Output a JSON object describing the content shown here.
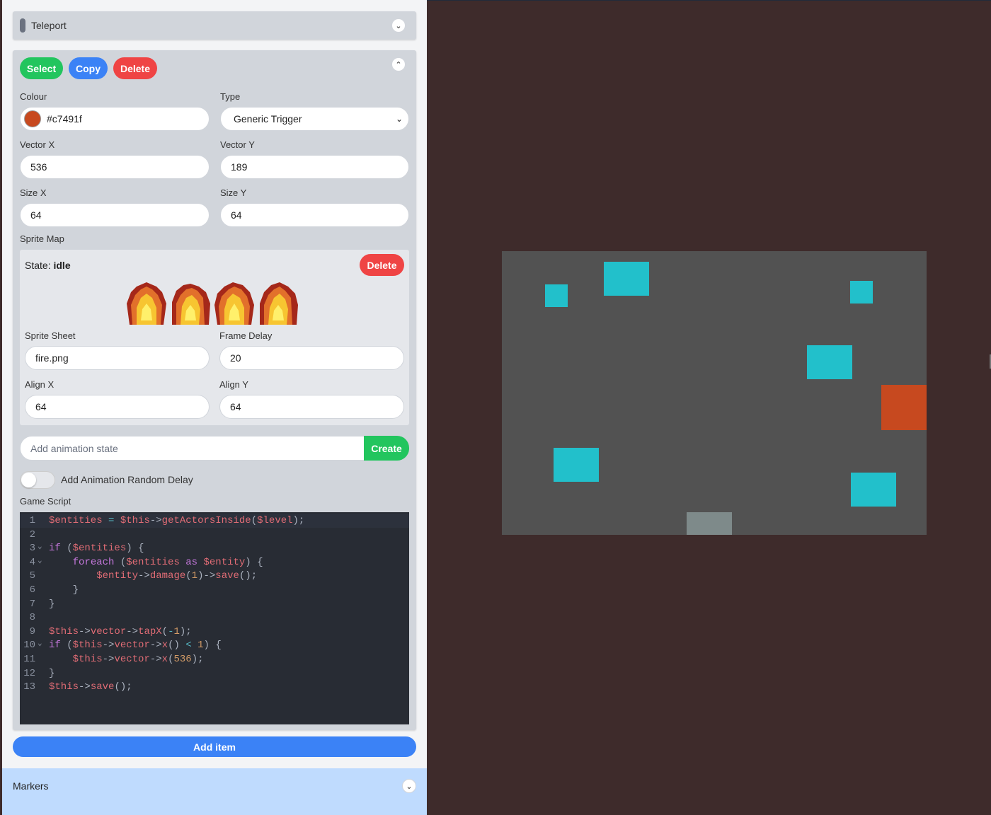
{
  "teleport_panel": {
    "title": "Teleport",
    "toggle_icon": "chevron-down-icon"
  },
  "item_panel": {
    "collapse_icon": "chevron-up-icon",
    "select_label": "Select",
    "copy_label": "Copy",
    "delete_label": "Delete",
    "colour": {
      "label": "Colour",
      "value": "#c7491f"
    },
    "type": {
      "label": "Type",
      "value": "Generic Trigger"
    },
    "vector_x": {
      "label": "Vector X",
      "value": "536"
    },
    "vector_y": {
      "label": "Vector Y",
      "value": "189"
    },
    "size_x": {
      "label": "Size X",
      "value": "64"
    },
    "size_y": {
      "label": "Size Y",
      "value": "64"
    },
    "sprite_map": {
      "label": "Sprite Map",
      "state_prefix": "State:",
      "state_name": "idle",
      "delete_label": "Delete",
      "sprite_sheet": {
        "label": "Sprite Sheet",
        "value": "fire.png"
      },
      "frame_delay": {
        "label": "Frame Delay",
        "value": "20"
      },
      "align_x": {
        "label": "Align X",
        "value": "64"
      },
      "align_y": {
        "label": "Align Y",
        "value": "64"
      }
    },
    "animation_state": {
      "placeholder": "Add animation state",
      "create_label": "Create"
    },
    "random_delay": {
      "label": "Add Animation Random Delay",
      "enabled": false
    },
    "game_script": {
      "label": "Game Script",
      "lines": [
        "$entities = $this->getActorsInside($level);",
        "",
        "if ($entities) {",
        "    foreach ($entities as $entity) {",
        "        $entity->damage(1)->save();",
        "    }",
        "}",
        "",
        "$this->vector->tapX(-1);",
        "if ($this->vector->x() < 1) {",
        "    $this->vector->x(536);",
        "}",
        "$this->save();"
      ]
    }
  },
  "add_item_label": "Add item",
  "markers_panel": {
    "title": "Markers",
    "toggle_icon": "chevron-down-icon"
  },
  "colors": {
    "stage_bg": "#3e2b2b",
    "level_bg": "#525252",
    "trigger": "#c7491f",
    "actor": "#22c0cb",
    "spawn": "#7e8a8a",
    "primary": "#3b82f6",
    "success": "#22c55e",
    "danger": "#ef4444"
  }
}
